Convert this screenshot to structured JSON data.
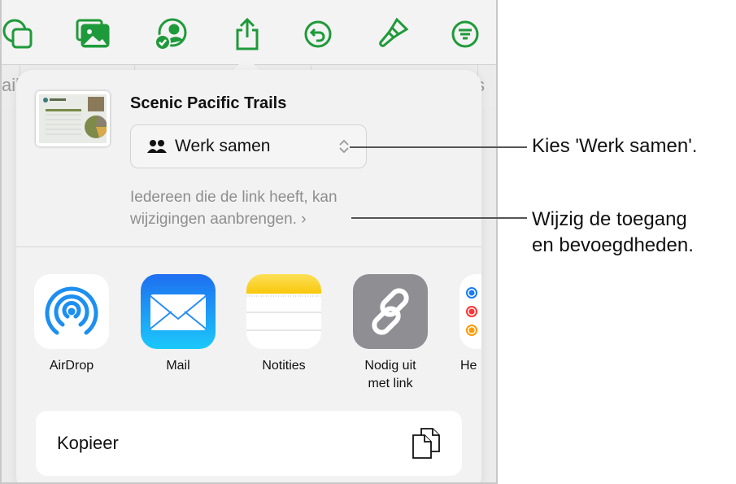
{
  "toolbar": {
    "icons": [
      "shapes-icon",
      "media-icon",
      "collaborate-icon",
      "share-icon",
      "undo-icon",
      "format-brush-icon",
      "organize-icon"
    ],
    "accent": "#1f9a3a"
  },
  "background": {
    "left_text": "ail",
    "right_text": "s"
  },
  "share_sheet": {
    "doc_title": "Scenic Pacific Trails",
    "access_select": {
      "value": "Werk samen",
      "icon": "people-icon"
    },
    "description_line1": "Iedereen die de link heeft, kan",
    "description_line2": "wijzigingen aanbrengen.",
    "apps": [
      {
        "label": "AirDrop",
        "icon": "airdrop-icon"
      },
      {
        "label": "Mail",
        "icon": "mail-icon"
      },
      {
        "label": "Notities",
        "icon": "notes-icon"
      },
      {
        "label_line1": "Nodig uit",
        "label_line2": "met link",
        "icon": "link-icon"
      },
      {
        "label": "He",
        "icon": "reminders-icon"
      }
    ],
    "copy_label": "Kopieer"
  },
  "callouts": {
    "first": "Kies 'Werk samen'.",
    "second_line1": "Wijzig de toegang",
    "second_line2": "en bevoegdheden."
  }
}
